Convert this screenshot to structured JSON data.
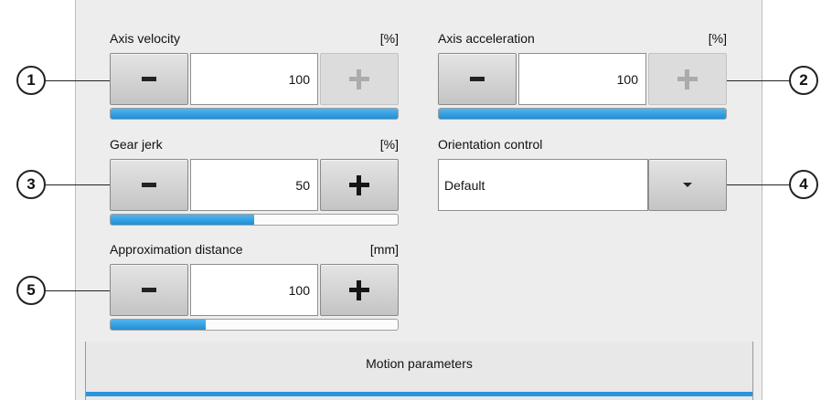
{
  "axis_velocity": {
    "label": "Axis velocity",
    "unit": "[%]",
    "minus_label": "-",
    "plus_label": "+",
    "value": "100",
    "level_percent": 100,
    "plus_enabled": false
  },
  "axis_acceleration": {
    "label": "Axis acceleration",
    "unit": "[%]",
    "minus_label": "-",
    "plus_label": "+",
    "value": "100",
    "level_percent": 100,
    "plus_enabled": false
  },
  "gear_jerk": {
    "label": "Gear jerk",
    "unit": "[%]",
    "minus_label": "-",
    "plus_label": "+",
    "value": "50",
    "level_percent": 50,
    "plus_enabled": true
  },
  "orientation_control": {
    "label": "Orientation control",
    "selected": "Default"
  },
  "approximation_distance": {
    "label": "Approximation distance",
    "unit": "[mm]",
    "minus_label": "-",
    "plus_label": "+",
    "value": "100",
    "level_fraction": 0.33,
    "plus_enabled": true
  },
  "callouts": [
    "1",
    "2",
    "3",
    "4",
    "5"
  ],
  "footer": {
    "tab_label": "Motion parameters"
  },
  "colors": {
    "accent": "#2a95dc",
    "panel": "#ededed",
    "button": "#d4d4d4"
  }
}
